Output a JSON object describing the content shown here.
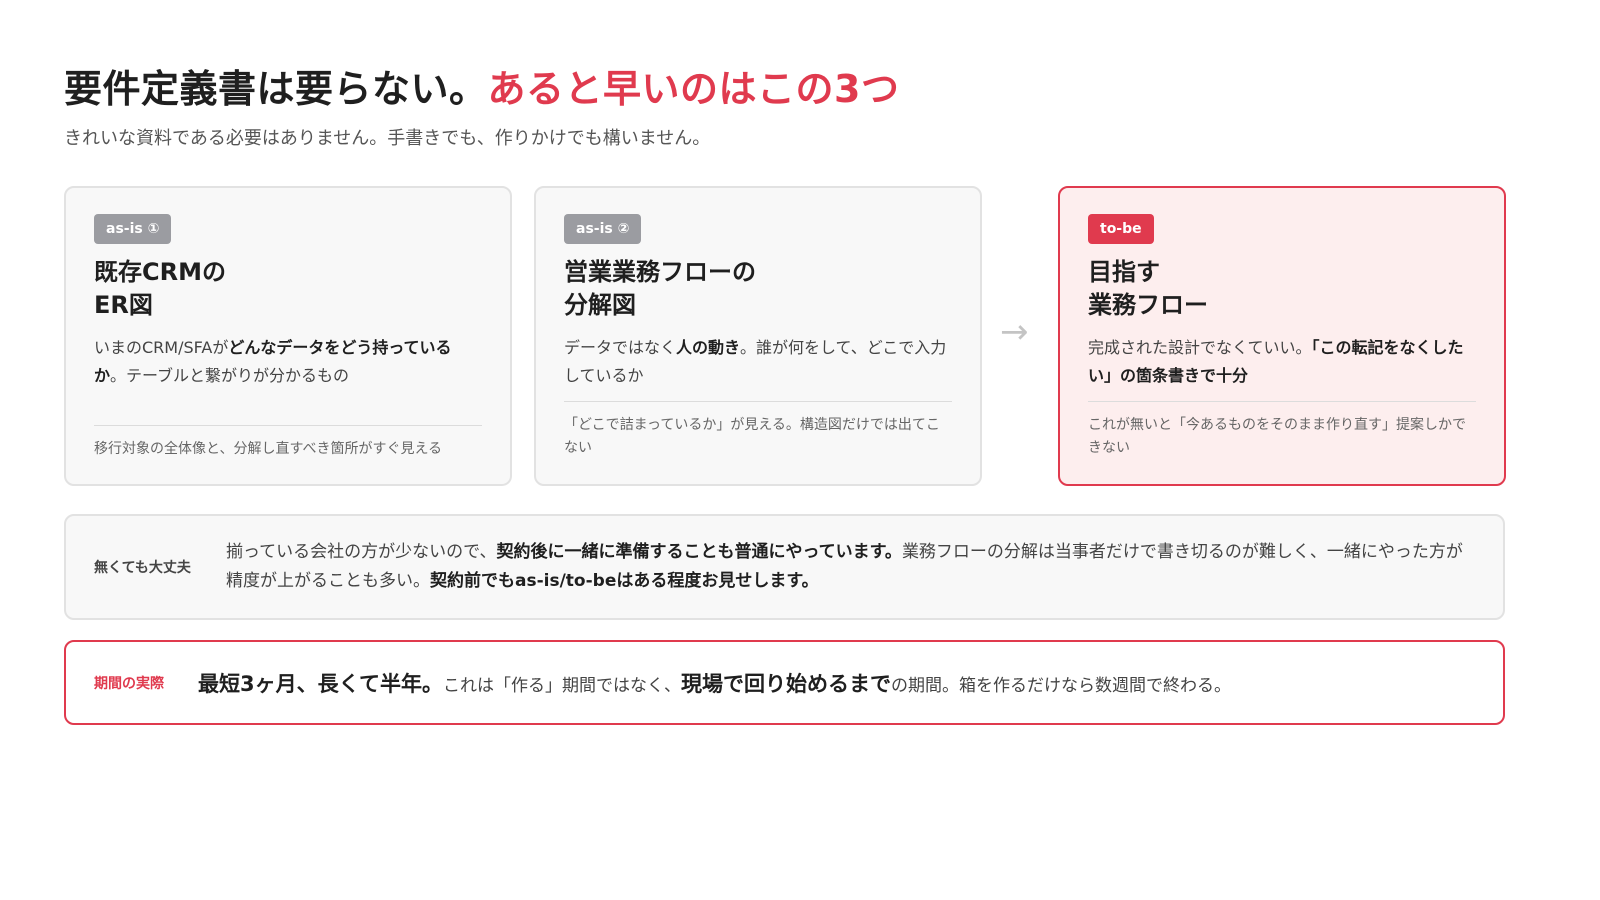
{
  "header": {
    "title_main": "要件定義書は要らない。",
    "title_accent": "あると早いのはこの3つ",
    "subtitle": "きれいな資料である必要はありません。手書きでも、作りかけでも構いません。"
  },
  "cards": [
    {
      "tag": "as-is ①",
      "title_line1": "既存CRMの",
      "title_line2": "ER図",
      "desc_pre": "いまのCRM/SFAが",
      "desc_bold": "どんなデータをどう持っているか",
      "desc_post": "。テーブルと繋がりが分かるもの",
      "note": "移行対象の全体像と、分解し直すべき箇所がすぐ見える"
    },
    {
      "tag": "as-is ②",
      "title_line1": "営業業務フローの",
      "title_line2": "分解図",
      "desc_pre": "データではなく",
      "desc_bold": "人の動き",
      "desc_post": "。誰が何をして、どこで入力しているか",
      "note": "「どこで詰まっているか」が見える。構造図だけでは出てこない"
    },
    {
      "tag": "to-be",
      "title_line1": "目指す",
      "title_line2": "業務フロー",
      "desc_pre": "完成された設計でなくていい。",
      "desc_bold": "「この転記をなくしたい」の箇条書きで十分",
      "desc_post": "",
      "note": "これが無いと「今あるものをそのまま作り直す」提案しかできない"
    }
  ],
  "arrow": "→",
  "notice": {
    "label": "無くても大丈夫",
    "text1": "揃っている会社の方が少ないので、",
    "bold1": "契約後に一緒に準備することも普通にやっています。",
    "text2": "業務フローの分解は当事者だけで書き切るのが難しく、一緒にやった方が精度が上がることも多い。",
    "bold2": "契約前でもas-is/to-beはある程度お見せします。"
  },
  "period": {
    "label": "期間の実際",
    "big1": "最短3ヶ月、長くて半年。",
    "text1": "これは「作る」期間ではなく、",
    "big2": "現場で回り始めるまで",
    "text2": "の期間。箱を作るだけなら数週間で終わる。"
  },
  "colors": {
    "accent": "#e03a4e",
    "tag_gray": "#9b9ca1",
    "card_bg": "#f8f8f8",
    "card_accent_bg": "#fdeeee"
  }
}
